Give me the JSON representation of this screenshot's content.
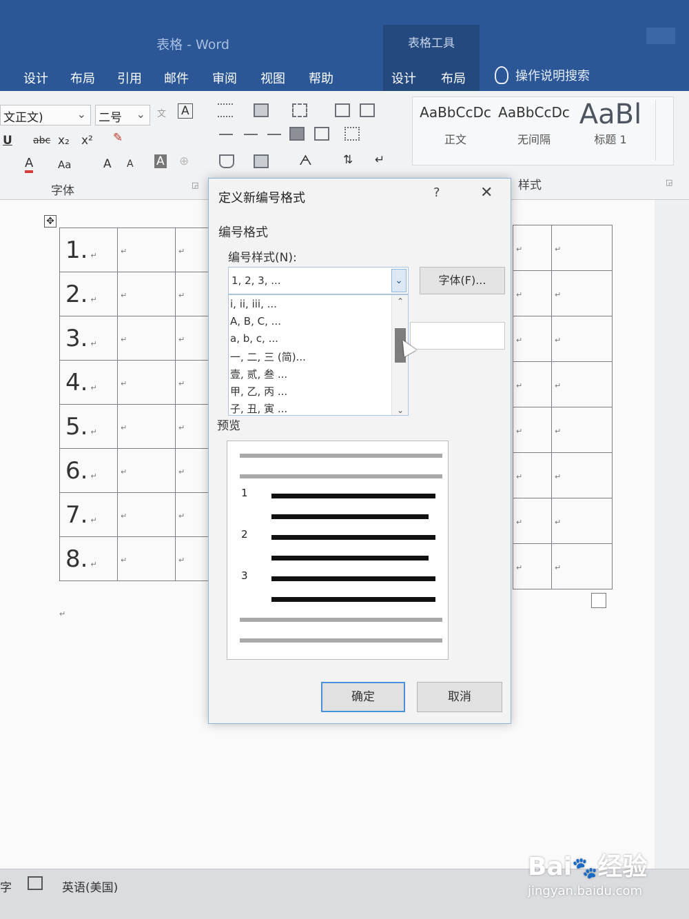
{
  "window": {
    "title": "表格 - Word",
    "context_group": "表格工具"
  },
  "ribbon_tabs": [
    "设计",
    "布局",
    "引用",
    "邮件",
    "审阅",
    "视图",
    "帮助"
  ],
  "context_tabs": [
    "设计",
    "布局"
  ],
  "tell_me": "操作说明搜索",
  "ribbon": {
    "font_name": "文正文)",
    "font_size": "二号",
    "font_group_label": "字体",
    "styles_group_label": "样式",
    "styles": [
      {
        "sample": "AaBbCcDc",
        "name": "正文"
      },
      {
        "sample": "AaBbCcDc",
        "name": "无间隔"
      },
      {
        "sample": "AaBl",
        "name": "标题 1"
      }
    ],
    "font_buttons": [
      "U",
      "abc",
      "x₂",
      "x²",
      "A",
      "Aa",
      "A",
      "A",
      "A"
    ]
  },
  "document": {
    "row_numbers": [
      "1.",
      "2.",
      "3.",
      "4.",
      "5.",
      "6.",
      "7.",
      "8."
    ],
    "cell_mark": "↵"
  },
  "dialog": {
    "title": "定义新编号格式",
    "help": "?",
    "close": "✕",
    "section_label": "编号格式",
    "style_label": "编号样式(N):",
    "selected_style": "1, 2, 3, ...",
    "font_button": "字体(F)...",
    "style_options": [
      "i, ii, iii, ...",
      "A, B, C, ...",
      "a, b, c, ...",
      "一, 二, 三 (简)...",
      "壹, 贰, 叁 ...",
      "甲, 乙, 丙 ...",
      "子, 丑, 寅 ..."
    ],
    "preview_label": "预览",
    "preview_numbers": [
      "1",
      "2",
      "3"
    ],
    "ok": "确定",
    "cancel": "取消"
  },
  "statusbar": {
    "words": "字",
    "language": "英语(美国)"
  },
  "watermark": {
    "logo": "Bai du 经验",
    "url": "jingyan.baidu.com"
  }
}
